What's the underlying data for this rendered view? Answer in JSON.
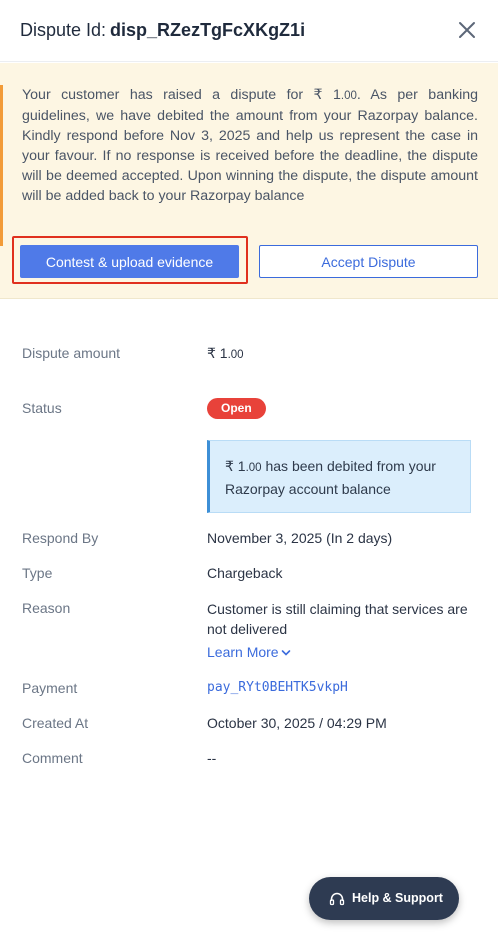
{
  "header": {
    "title_label": "Dispute Id:",
    "dispute_id": "disp_RZezTgFcXKgZ1i"
  },
  "banner": {
    "message_part1": "Your customer has raised a dispute for ₹ 1",
    "message_decimals": ".00",
    "message_part2": ". As per banking guidelines, we have debited the amount from your Razorpay balance. Kindly respond before Nov 3, 2025 and help us represent the case in your favour. If no response is received before the deadline, the dispute will be deemed accepted. Upon winning the dispute, the dispute amount will be added back to your Razorpay balance",
    "contest_label": "Contest & upload evidence",
    "accept_label": "Accept Dispute"
  },
  "details": {
    "amount_label": "Dispute amount",
    "amount_symbol": "₹ 1",
    "amount_decimals": ".00",
    "status_label": "Status",
    "status_value": "Open",
    "info_amount": "₹ 1",
    "info_decimals": ".00",
    "info_text": " has been debited from your Razorpay account balance",
    "respond_label": "Respond By",
    "respond_value": "November 3, 2025 (In 2 days)",
    "type_label": "Type",
    "type_value": "Chargeback",
    "reason_label": "Reason",
    "reason_value": "Customer is still claiming that services are not delivered",
    "learn_more": "Learn More",
    "payment_label": "Payment",
    "payment_value": "pay_RYt0BEHTK5vkpH",
    "created_label": "Created At",
    "created_value": "October 30, 2025 / 04:29 PM",
    "comment_label": "Comment",
    "comment_value": "--"
  },
  "help": {
    "label": "Help & Support"
  },
  "colors": {
    "primary": "#4f7ae8",
    "link": "#3b6bdc",
    "danger": "#e8423a",
    "warning_accent": "#f29b38",
    "banner_bg": "#fdf6e3",
    "info_bg": "#dbeefc"
  },
  "icons": {
    "close": "close-icon",
    "chevron": "chevron-down-icon",
    "headset": "headset-icon"
  }
}
